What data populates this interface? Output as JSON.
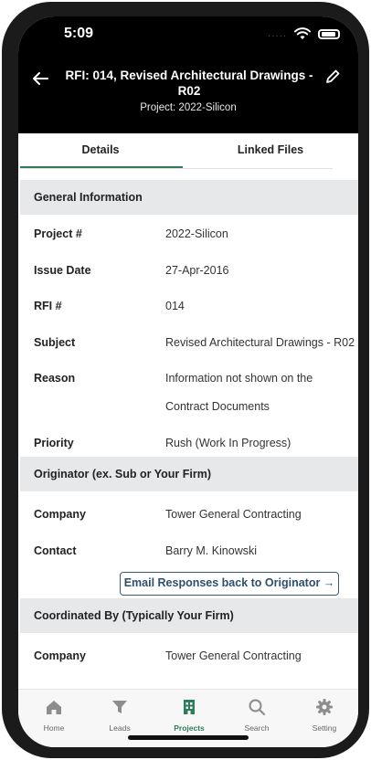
{
  "status_bar": {
    "time": "5:09",
    "signal_dots": "....."
  },
  "header": {
    "title": "RFI: 014, Revised Architectural Drawings - R02",
    "subtitle": "Project: 2022-Silicon"
  },
  "tabs": [
    {
      "label": "Details",
      "active": true
    },
    {
      "label": "Linked Files",
      "active": false
    }
  ],
  "sections": {
    "general": {
      "title": "General Information",
      "rows": [
        {
          "label": "Project #",
          "value": "2022-Silicon"
        },
        {
          "label": "Issue Date",
          "value": "27-Apr-2016"
        },
        {
          "label": "RFI #",
          "value": "014"
        },
        {
          "label": "Subject",
          "value": "Revised Architectural Drawings - R02"
        },
        {
          "label": "Reason",
          "value_line1": "Information not shown on the",
          "value_line2": "Contract Documents"
        },
        {
          "label": "Priority",
          "value": "Rush (Work In Progress)"
        }
      ]
    },
    "originator": {
      "title": "Originator (ex. Sub or Your Firm)",
      "rows": [
        {
          "label": "Company",
          "value": "Tower General Contracting"
        },
        {
          "label": "Contact",
          "value": "Barry M. Kinowski"
        }
      ],
      "email_button": "Email Responses back to Originator →"
    },
    "coordinated": {
      "title": "Coordinated By (Typically Your Firm)",
      "rows": [
        {
          "label": "Company",
          "value": "Tower General Contracting"
        }
      ]
    }
  },
  "bottom_nav": [
    {
      "label": "Home",
      "icon": "home-icon",
      "active": false
    },
    {
      "label": "Leads",
      "icon": "filter-icon",
      "active": false
    },
    {
      "label": "Projects",
      "icon": "building-icon",
      "active": true
    },
    {
      "label": "Search",
      "icon": "search-icon",
      "active": false
    },
    {
      "label": "Setting",
      "icon": "gear-icon",
      "active": false
    }
  ],
  "colors": {
    "accent": "#2e7d5a",
    "header_bg": "#000000",
    "section_bg": "#e6e8ea",
    "button_border": "#3a5a7a"
  }
}
